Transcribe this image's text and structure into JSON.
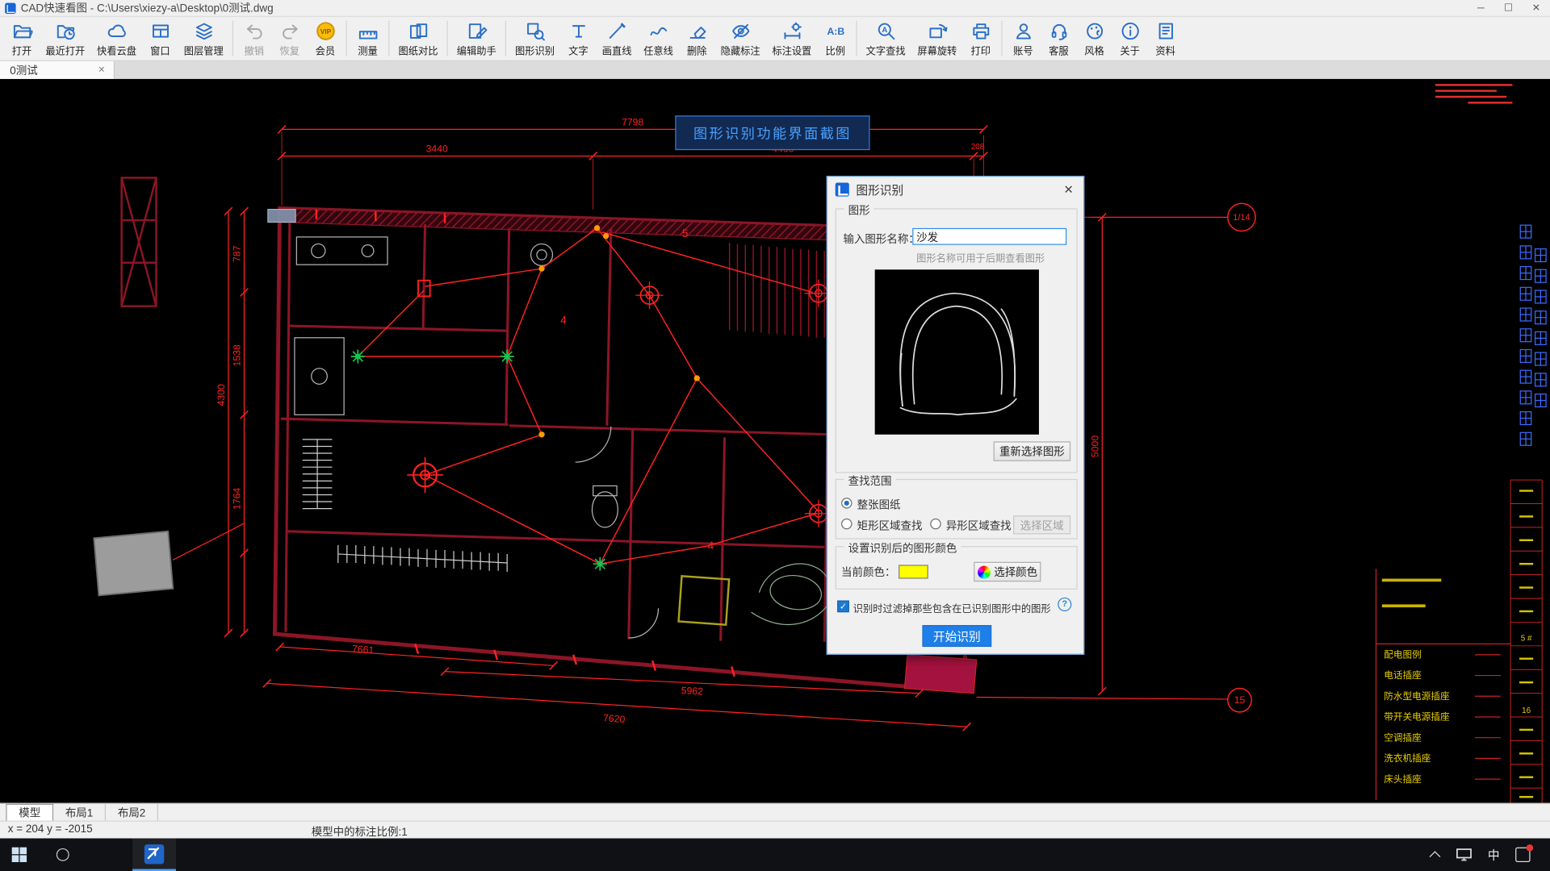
{
  "window": {
    "title": "CAD快速看图 - C:\\Users\\xiezy-a\\Desktop\\0测试.dwg",
    "controls": {
      "minimize": "─",
      "maximize": "☐",
      "close": "✕"
    }
  },
  "icons": {
    "tab_close": "×",
    "dialog_close": "✕",
    "check": "✓",
    "help": "?"
  },
  "toolbar": {
    "items": [
      {
        "label": "打开"
      },
      {
        "label": "最近打开"
      },
      {
        "label": "快看云盘"
      },
      {
        "label": "窗口"
      },
      {
        "label": "图层管理"
      },
      {
        "label": "撤销",
        "disabled": true
      },
      {
        "label": "恢复",
        "disabled": true
      },
      {
        "label": "会员"
      },
      {
        "label": "测量"
      },
      {
        "label": "图纸对比"
      },
      {
        "label": "编辑助手"
      },
      {
        "label": "图形识别"
      },
      {
        "label": "文字"
      },
      {
        "label": "画直线"
      },
      {
        "label": "任意线"
      },
      {
        "label": "删除"
      },
      {
        "label": "隐藏标注"
      },
      {
        "label": "标注设置"
      },
      {
        "label": "比例"
      },
      {
        "label": "文字查找"
      },
      {
        "label": "屏幕旋转"
      },
      {
        "label": "打印"
      },
      {
        "label": "账号"
      },
      {
        "label": "客服"
      },
      {
        "label": "风格"
      },
      {
        "label": "关于"
      },
      {
        "label": "资料"
      }
    ]
  },
  "doc_tabs": [
    {
      "label": "0测试"
    }
  ],
  "canvas": {
    "banner": "图形识别功能界面截图",
    "dims": {
      "d7798": "7798",
      "d3440": "3440",
      "d4400": "4400",
      "d208": "208",
      "d787": "787",
      "d1538": "1538",
      "d4300": "4300",
      "d1764": "1764",
      "d5000": "5000",
      "d7661": "7661",
      "d5962": "5962",
      "d7620": "7620"
    },
    "callouts": {
      "top": "1/14",
      "bottom": "15"
    },
    "circuit": {
      "n5": "5",
      "n4a": "4",
      "n4b": "4"
    },
    "legend": {
      "items": [
        "配电图例",
        "电话插座",
        "防水型电源插座",
        "带开关电源插座",
        "空调插座",
        "洗衣机插座",
        "床头插座"
      ],
      "strip": [
        "5 #",
        "16"
      ]
    }
  },
  "dialog": {
    "title": "图形识别",
    "group_graphic": "图形",
    "name_label": "输入图形名称：",
    "name_value": "沙发",
    "name_hint": "图形名称可用于后期查看图形",
    "reselect": "重新选择图形",
    "group_range": "查找范围",
    "radio_whole": "整张图纸",
    "radio_rect": "矩形区域查找",
    "radio_poly": "异形区域查找",
    "select_area": "选择区域",
    "group_color": "设置识别后的图形颜色",
    "current_color_label": "当前颜色：",
    "current_color": "#ffff00",
    "accent_color": "#1f7fe8",
    "choose_color": "选择颜色",
    "filter_label": "识别时过滤掉那些包含在已识别图形中的图形",
    "start": "开始识别"
  },
  "bottom_tabs": [
    {
      "label": "模型"
    },
    {
      "label": "布局1"
    },
    {
      "label": "布局2"
    }
  ],
  "statusbar": {
    "coords": "x = 204 y = -2015",
    "scale": "模型中的标注比例:1"
  },
  "taskbar": {
    "input_indicator": "中"
  }
}
